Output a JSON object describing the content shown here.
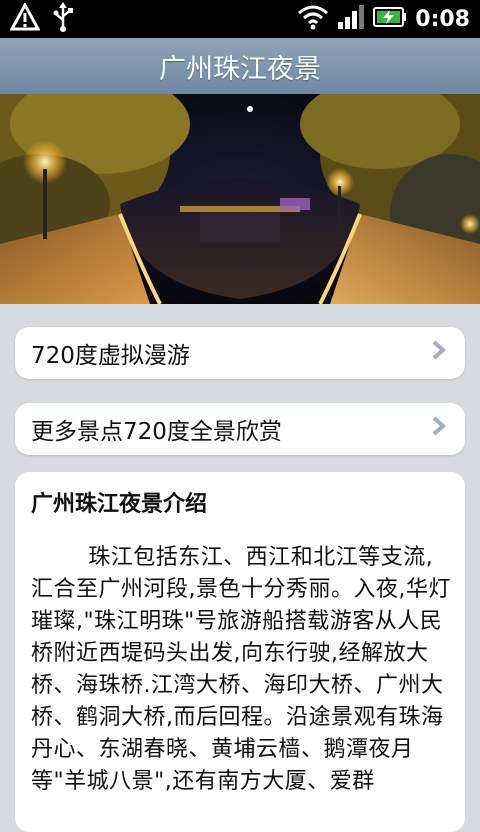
{
  "status_bar": {
    "time": "0:08",
    "icons": [
      "warning-icon",
      "usb-icon",
      "wifi-icon",
      "signal-icon",
      "battery-charging-icon"
    ]
  },
  "title_bar": {
    "title": "广州珠江夜景"
  },
  "hero": {
    "image": "pearl-river-night-panorama"
  },
  "menu": [
    {
      "label": "720度虚拟漫游",
      "icon": "chevron-right-icon"
    },
    {
      "label": "更多景点720度全景欣赏",
      "icon": "chevron-right-icon"
    }
  ],
  "intro": {
    "title": "广州珠江夜景介绍",
    "body": "珠江包括东江、西江和北江等支流,汇合至广州河段,景色十分秀丽。入夜,华灯璀璨,\"珠江明珠\"号旅游船搭载游客从人民桥附近西堤码头出发,向东行驶,经解放大桥、海珠桥.江湾大桥、海印大桥、广州大桥、鹤洞大桥,而后回程。沿途景观有珠海丹心、东湖春晓、黄埔云樯、鹅潭夜月等\"羊城八景\",还有南方大厦、爱群"
  },
  "colors": {
    "titlebar": "#7f97ae",
    "background": "#d4dbe2",
    "card": "#ffffff"
  }
}
